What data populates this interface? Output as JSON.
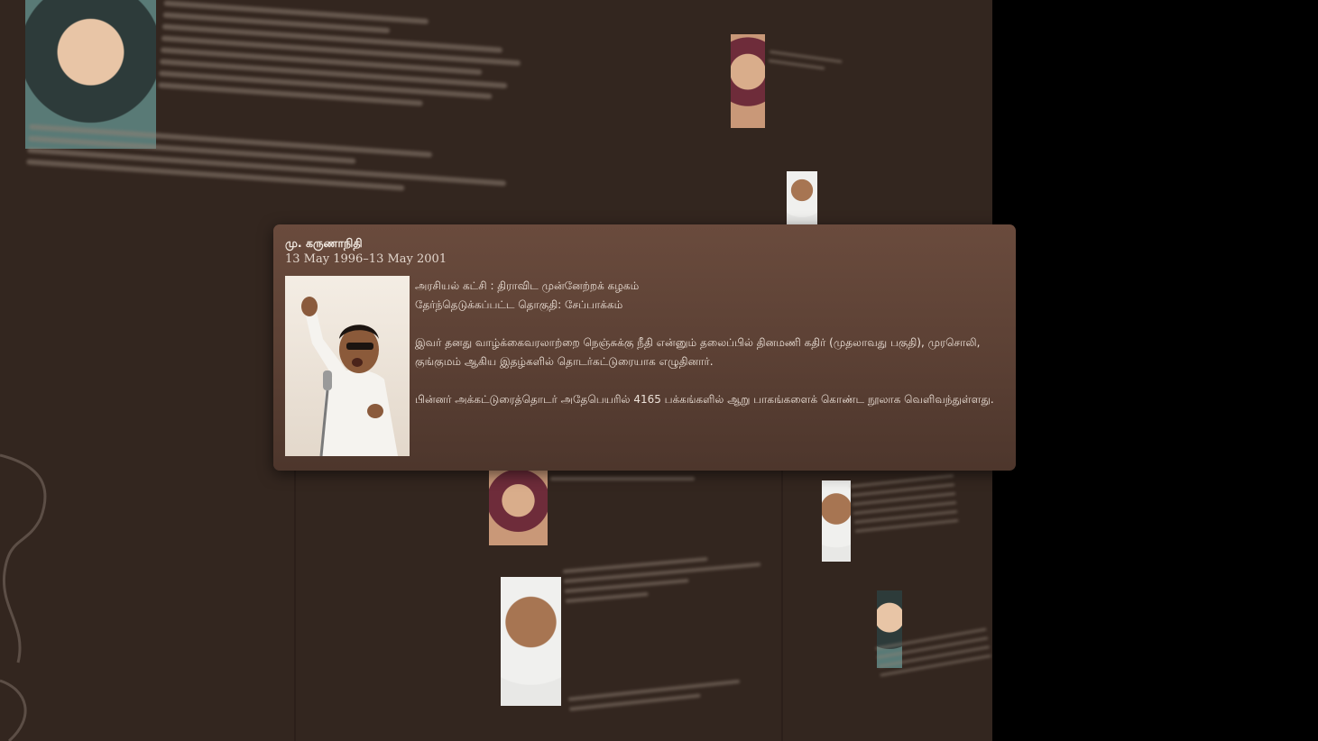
{
  "popup": {
    "name": "மு. கருணாநிதி",
    "dates": "13 May 1996–13 May 2001",
    "party": "அரசியல் கட்சி : திராவிட முன்னேற்றக் கழகம்",
    "constituency": "தேர்ந்தெடுக்கப்பட்ட தொகுதி: சேப்பாக்கம்",
    "bio_1": "இவர் தனது வாழ்க்கைவரலாற்றை நெஞ்சுக்கு நீதி என்னும் தலைப்பில் தினமணி கதிர் (முதலாவது பகுதி), முரசொலி, குங்குமம் ஆகிய இதழ்களில் தொடர்கட்டுரையாக எழுதினார்.",
    "bio_2": "பின்னர் அக்கட்டுரைத்தொடர் அதேபெயரில் 4165 பக்கங்களில் ஆறு பாகங்களைக் கொண்ட நூலாக வெளிவந்துள்ளது.",
    "photo_icon": "speaker-portrait-icon"
  },
  "colors": {
    "wall": "#33261f",
    "popup": "#5b4034",
    "text": "#eee3da"
  }
}
